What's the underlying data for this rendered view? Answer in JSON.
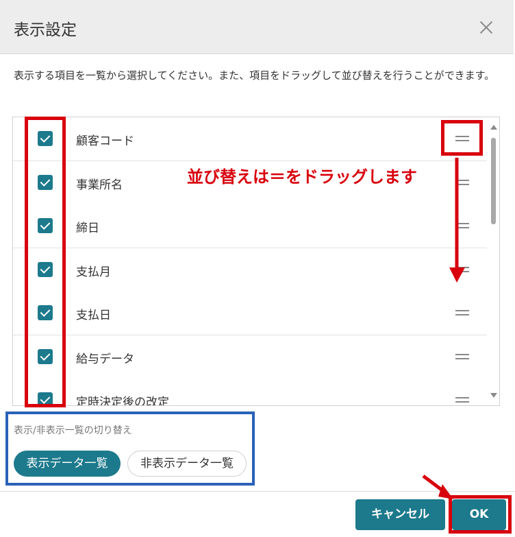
{
  "dialog": {
    "title": "表示設定",
    "close_icon": "close-icon",
    "description": "表示する項目を一覧から選択してください。また、項目をドラッグして並び替えを行うことができます。"
  },
  "items": [
    {
      "label": "顧客コード",
      "checked": true
    },
    {
      "label": "事業所名",
      "checked": true
    },
    {
      "label": "締日",
      "checked": true
    },
    {
      "label": "支払月",
      "checked": true
    },
    {
      "label": "支払日",
      "checked": true
    },
    {
      "label": "給与データ",
      "checked": true
    },
    {
      "label": "定時決定後の改定",
      "checked": true
    }
  ],
  "toggle": {
    "label": "表示/非表示一覧の切り替え",
    "show_button": "表示データ一覧",
    "hide_button": "非表示データ一覧"
  },
  "footer": {
    "cancel_label": "キャンセル",
    "ok_label": "OK"
  },
  "annotation": {
    "text": "並び替えは＝をドラッグします",
    "color": "#d8000c",
    "highlight_blue": "#2a62b8"
  },
  "colors": {
    "accent": "#1c7a8c",
    "header_bg": "#ededed"
  }
}
